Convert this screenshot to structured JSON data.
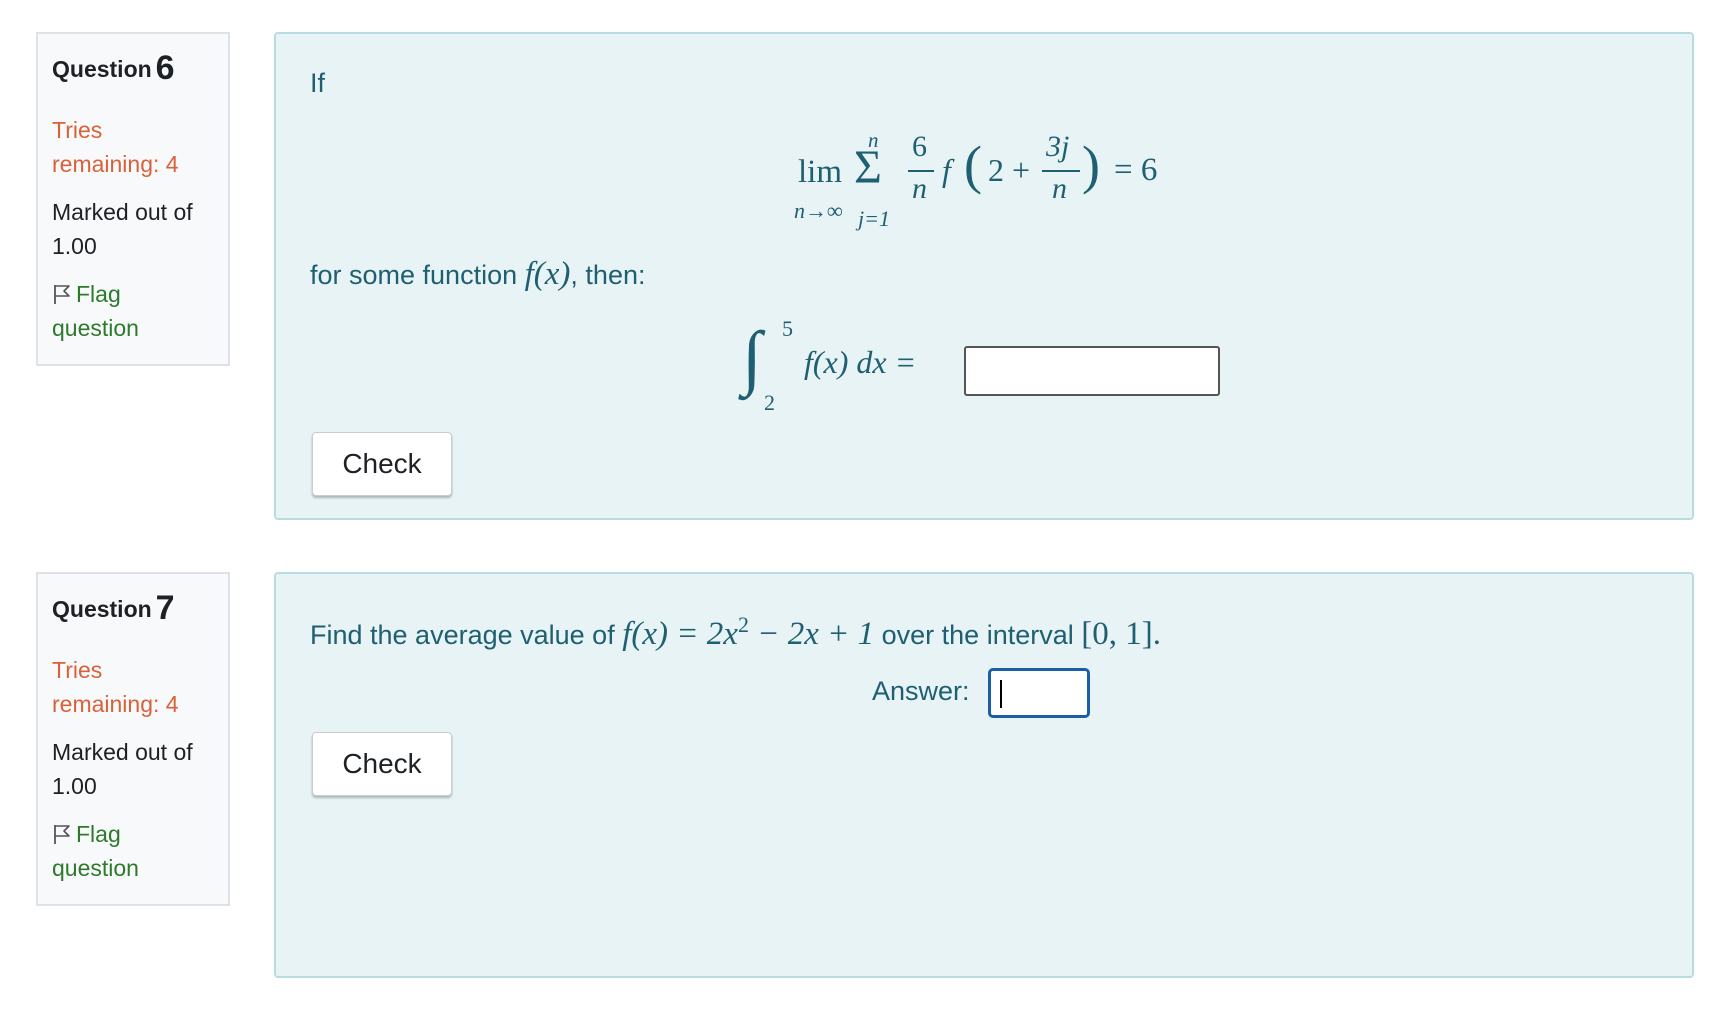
{
  "questions": [
    {
      "label": "Question",
      "number": "6",
      "state": "Tries remaining: 4",
      "grade": "Marked out of 1.00",
      "flag": "Flag question",
      "intro": "If",
      "limit_word": "lim",
      "limit_sub": "n→∞",
      "sum_top": "n",
      "sum_bottom": "j=1",
      "frac_num": "6",
      "frac_den": "n",
      "f_sym": "f",
      "paren_open": "(",
      "two_plus": "2 +",
      "inner_num": "3j",
      "inner_den": "n",
      "paren_close": ")",
      "equals_six": "= 6",
      "followup_text": "for some function",
      "followup_func": "f(x)",
      "followup_end": ", then:",
      "integral_upper": "5",
      "integral_lower": "2",
      "integrand": "f(x) dx =",
      "answer_value": "",
      "check_label": "Check"
    },
    {
      "label": "Question",
      "number": "7",
      "state": "Tries remaining: 4",
      "grade": "Marked out of 1.00",
      "flag": "Flag question",
      "prompt_start": "Find the average value of",
      "prompt_fx": "f(x) = 2x",
      "prompt_exp": "2",
      "prompt_rest": " − 2x + 1",
      "prompt_mid": "over the interval",
      "prompt_interval": "[0, 1].",
      "answer_label": "Answer:",
      "answer_value": "",
      "check_label": "Check"
    }
  ],
  "colors": {
    "content_bg": "#e7f3f5",
    "content_border": "#b8dce2",
    "text_primary": "#1f5f72",
    "state_text": "#d9613a",
    "flag_text": "#2d7a2d",
    "focus_border": "#1a5ea8"
  },
  "icons": {
    "flag": "flag-icon"
  }
}
